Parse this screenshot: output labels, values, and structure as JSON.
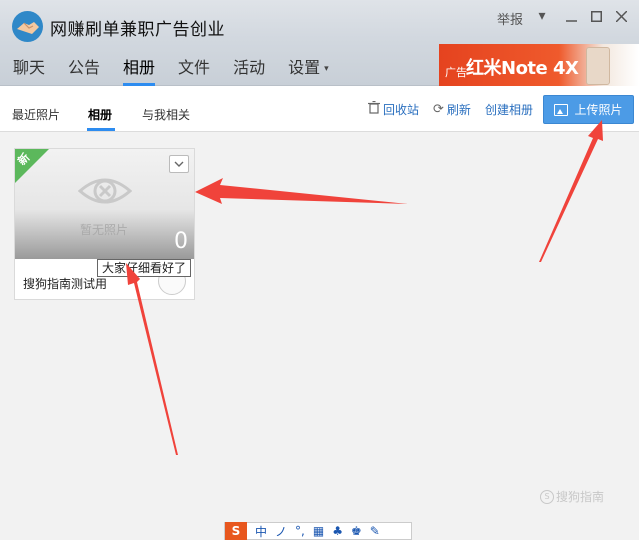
{
  "window": {
    "group_name": "网赚刷单兼职广告创业",
    "report": "举报"
  },
  "main_tabs": [
    {
      "label": "聊天"
    },
    {
      "label": "公告"
    },
    {
      "label": "相册"
    },
    {
      "label": "文件"
    },
    {
      "label": "活动"
    },
    {
      "label": "设置"
    }
  ],
  "ad": {
    "tag": "广告",
    "title": "红米Note 4X"
  },
  "sub_tabs": [
    {
      "label": "最近照片"
    },
    {
      "label": "相册"
    },
    {
      "label": "与我相关"
    }
  ],
  "toolbar": {
    "recycle": "回收站",
    "refresh": "刷新",
    "create_album": "创建相册",
    "upload": "上传照片"
  },
  "album": {
    "badge": "新",
    "empty_text": "暂无照片",
    "count": "0",
    "name": "搜狗指南测试用"
  },
  "tooltip": "大家仔细看好了",
  "watermark": "搜狗指南",
  "ime": {
    "logo": "S",
    "mode": "中",
    "items": [
      "ノ",
      "°,",
      "▦",
      "♣",
      "♚",
      "✎"
    ]
  },
  "colors": {
    "accent": "#2d8cf0",
    "upload_button": "#4c9be6",
    "ad_red": "#e5431f",
    "new_badge": "#5cb85c",
    "arrow": "#f0433b"
  }
}
